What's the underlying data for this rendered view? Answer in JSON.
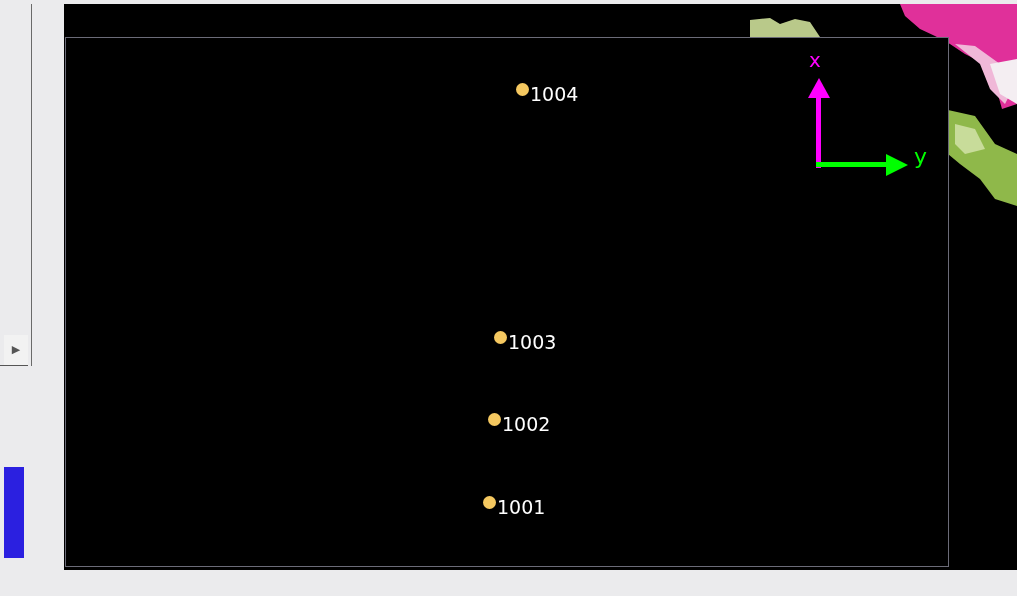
{
  "viewport": {
    "points": [
      {
        "label": "1004"
      },
      {
        "label": "1003"
      },
      {
        "label": "1002"
      },
      {
        "label": "1001"
      }
    ],
    "axes": {
      "x_label": "x",
      "y_label": "y"
    }
  },
  "sidebar": {
    "expand_button": "▶"
  }
}
